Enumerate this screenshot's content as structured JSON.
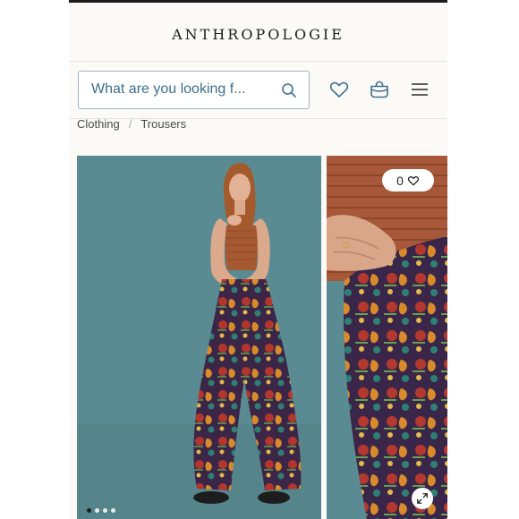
{
  "header": {
    "logo": "ANTHROPOLOGIE",
    "search": {
      "placeholder": "What are you looking f..."
    },
    "icons": [
      "heart-icon",
      "bag-icon",
      "menu-icon"
    ]
  },
  "breadcrumb": {
    "items": [
      "Clothing",
      "Trousers"
    ],
    "separator": "/"
  },
  "gallery": {
    "favorites_count": "0",
    "dot_count": 4,
    "active_dot": 0
  },
  "colors": {
    "accent": "#3d6f8f",
    "background": "#fbfaf7",
    "image_bg": "#5b8b92"
  }
}
